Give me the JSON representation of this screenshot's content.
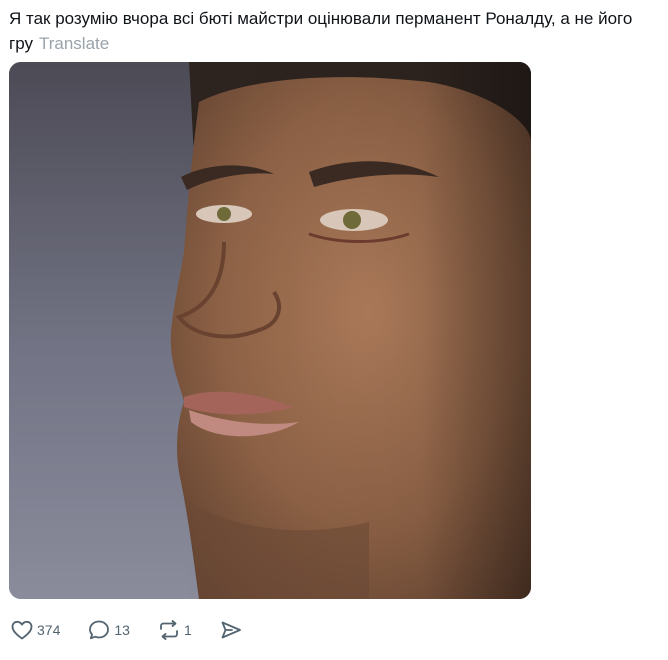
{
  "post": {
    "text": "Я так розумію вчора всі бюті майстри оцінювали перманент Роналду, а не його гру",
    "translate_label": "Translate"
  },
  "media": {
    "alt": "photo"
  },
  "actions": {
    "likes": "374",
    "replies": "13",
    "reposts": "1"
  },
  "colors": {
    "text": "#0f1419",
    "muted": "#536471",
    "translate": "#9aa3ab",
    "icon": "#536471"
  },
  "icons": {
    "like": "heart-icon",
    "reply": "speech-bubble-icon",
    "repost": "repost-arrows-icon",
    "share": "paper-plane-icon"
  }
}
